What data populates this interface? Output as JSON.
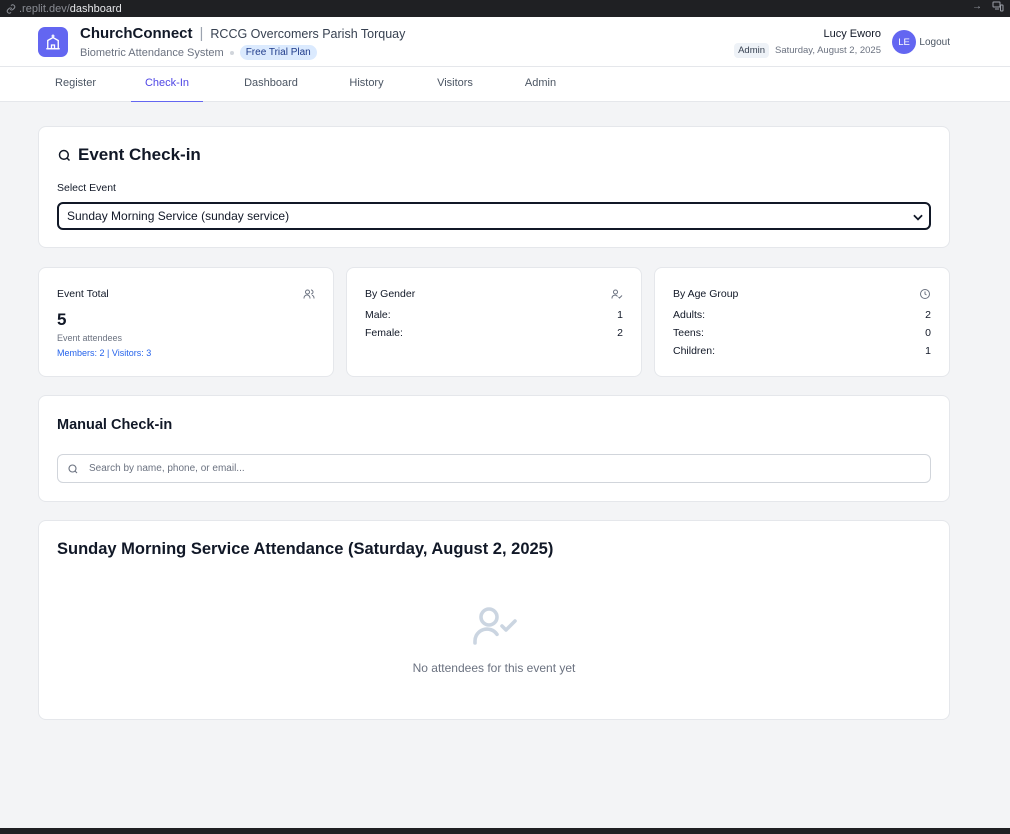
{
  "browser": {
    "url_host": ".replit.dev/",
    "url_path": "dashboard"
  },
  "header": {
    "app_name": "ChurchConnect",
    "separator": "|",
    "parish": "RCCG Overcomers Parish Torquay",
    "subtitle": "Biometric Attendance System",
    "plan": "Free Trial Plan",
    "user_name": "Lucy Eworo",
    "role": "Admin",
    "date": "Saturday, August 2, 2025",
    "avatar_initials": "LE",
    "logout": "Logout"
  },
  "tabs": [
    {
      "label": "Register",
      "active": false
    },
    {
      "label": "Check-In",
      "active": true
    },
    {
      "label": "Dashboard",
      "active": false
    },
    {
      "label": "History",
      "active": false
    },
    {
      "label": "Visitors",
      "active": false
    },
    {
      "label": "Admin",
      "active": false
    }
  ],
  "event_checkin": {
    "title": "Event Check-in",
    "select_label": "Select Event",
    "selected_event": "Sunday Morning Service (sunday service)"
  },
  "stats": {
    "total": {
      "title": "Event Total",
      "value": "5",
      "subtitle": "Event attendees",
      "breakdown": "Members: 2 | Visitors: 3"
    },
    "gender": {
      "title": "By Gender",
      "rows": [
        {
          "label": "Male:",
          "value": "1"
        },
        {
          "label": "Female:",
          "value": "2"
        }
      ]
    },
    "age": {
      "title": "By Age Group",
      "rows": [
        {
          "label": "Adults:",
          "value": "2"
        },
        {
          "label": "Teens:",
          "value": "0"
        },
        {
          "label": "Children:",
          "value": "1"
        }
      ]
    }
  },
  "manual_checkin": {
    "title": "Manual Check-in",
    "search_placeholder": "Search by name, phone, or email...",
    "search_value": ""
  },
  "attendance": {
    "title": "Sunday Morning Service Attendance (Saturday, August 2, 2025)",
    "empty_message": "No attendees for this event yet"
  },
  "colors": {
    "accent": "#6366f1",
    "active_tab": "#4f46e5",
    "link": "#2563eb",
    "background": "#f3f4f6"
  }
}
